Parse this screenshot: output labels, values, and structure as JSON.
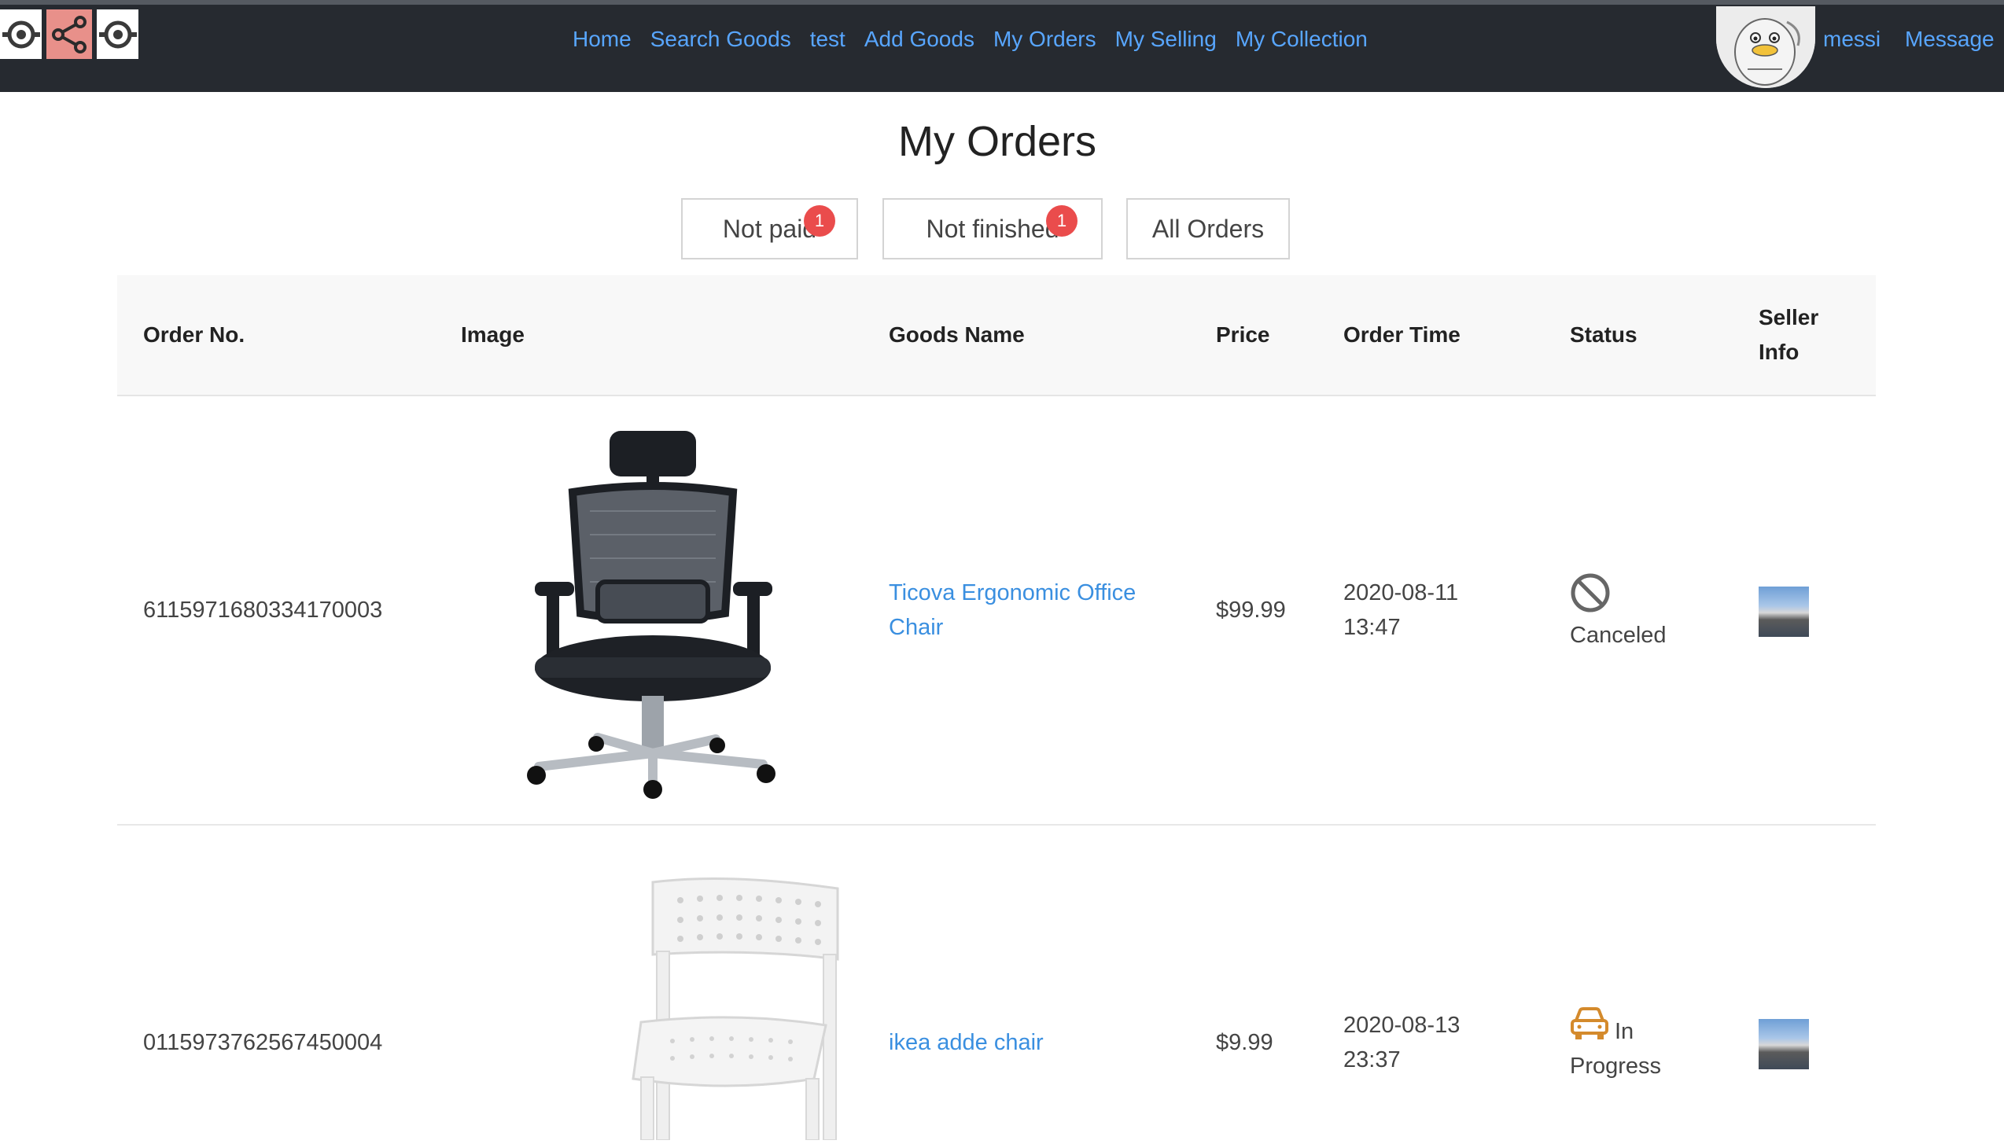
{
  "nav": {
    "items": [
      {
        "label": "Home"
      },
      {
        "label": "Search Goods"
      },
      {
        "label": "test"
      },
      {
        "label": "Add Goods"
      },
      {
        "label": "My Orders"
      },
      {
        "label": "My Selling"
      },
      {
        "label": "My Collection"
      }
    ],
    "username": "messi",
    "message": "Message"
  },
  "page": {
    "title": "My Orders"
  },
  "filters": [
    {
      "label": "Not paid",
      "badge": "1"
    },
    {
      "label": "Not finished",
      "badge": "1"
    },
    {
      "label": "All Orders"
    }
  ],
  "table": {
    "headers": [
      "Order No.",
      "Image",
      "Goods Name",
      "Price",
      "Order Time",
      "Status",
      "Seller",
      "Info"
    ],
    "rows": [
      {
        "order_no": "6115971680334170003",
        "goods_name_line1": "Ticova Ergonomic Office",
        "goods_name_line2": "Chair",
        "price": "$99.99",
        "date": "2020-08-11",
        "time": "13:47",
        "status": "Canceled",
        "status_icon": "ban-icon"
      },
      {
        "order_no": "0115973762567450004",
        "goods_name_line1": "ikea adde chair",
        "price": "$9.99",
        "date": "2020-08-13",
        "time": "23:37",
        "status_line1": "In",
        "status_line2": "Progress",
        "status_icon": "delivery-car-icon"
      }
    ]
  },
  "colors": {
    "topbar": "#262a30",
    "link": "#58a6ff",
    "badge": "#ea4c4c",
    "status_progress": "#d48a2c"
  }
}
